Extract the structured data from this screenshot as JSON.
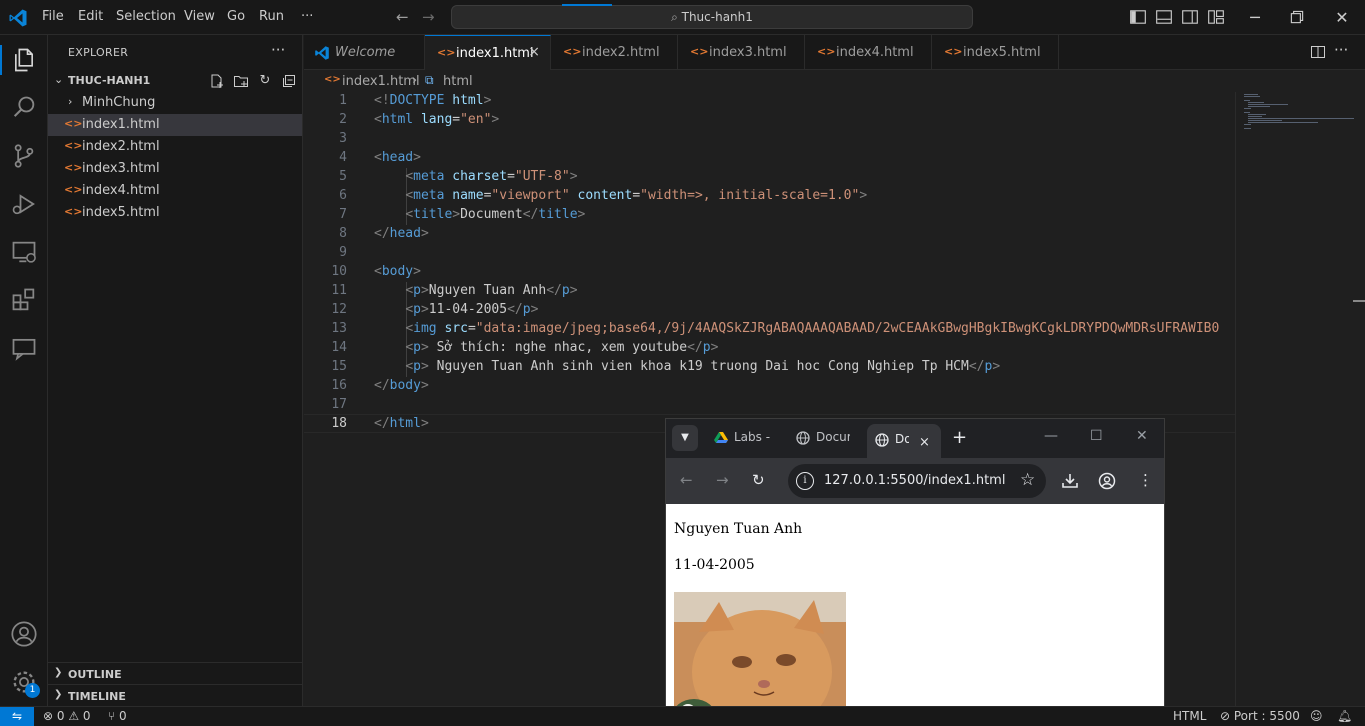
{
  "titlebar": {
    "menus": [
      "File",
      "Edit",
      "Selection",
      "View",
      "Go",
      "Run",
      "···"
    ],
    "search_text": "Thuc-hanh1"
  },
  "explorer": {
    "title": "EXPLORER",
    "more": "···",
    "folder": "THUC-HANH1",
    "items": [
      {
        "label": "MinhChung",
        "type": "folder"
      },
      {
        "label": "index1.html",
        "type": "file"
      },
      {
        "label": "index2.html",
        "type": "file"
      },
      {
        "label": "index3.html",
        "type": "file"
      },
      {
        "label": "index4.html",
        "type": "file"
      },
      {
        "label": "index5.html",
        "type": "file"
      }
    ],
    "outline": "OUTLINE",
    "timeline": "TIMELINE"
  },
  "tabs": [
    {
      "label": "Welcome"
    },
    {
      "label": "index1.html",
      "close": "×"
    },
    {
      "label": "index2.html"
    },
    {
      "label": "index3.html"
    },
    {
      "label": "index4.html"
    },
    {
      "label": "index5.html"
    }
  ],
  "breadcrumb": {
    "file": "index1.html",
    "sep": "›",
    "node": "html"
  },
  "editor": {
    "line_numbers": [
      "1",
      "2",
      "3",
      "4",
      "5",
      "6",
      "7",
      "8",
      "9",
      "10",
      "11",
      "12",
      "13",
      "14",
      "15",
      "16",
      "17",
      "18"
    ],
    "doctype": "<!DOCTYPE html>",
    "html_lang_attr": "lang",
    "html_lang_val": "\"en\"",
    "meta_charset_val": "\"UTF-8\"",
    "meta_viewport_name": "\"viewport\"",
    "meta_viewport_content": "\"width=>, initial-scale=1.0\"",
    "title_text": "Document",
    "p1_text": "Nguyen Tuan Anh",
    "p2_text": "11-04-2005",
    "img_src": "\"data:image/jpeg;base64,/9j/4AAQSkZJRgABAQAAAQABAAD/2wCEAAkGBwgHBgkIBwgKCgkLDRYPDQwMDRsUFRAWIB0",
    "p3_text": " Sở thích: nghe nhac, xem youtube",
    "p4_text": " Nguyen Tuan Anh sinh vien khoa k19 truong Dai hoc Cong Nghiep Tp HCM"
  },
  "browser": {
    "tabs": [
      "Labs -",
      "Docur",
      "Do"
    ],
    "tab_close": "×",
    "new_tab": "+",
    "url": "127.0.0.1:5500/index1.html",
    "page_lines": [
      "Nguyen Tuan Anh",
      "11-04-2005"
    ]
  },
  "statusbar": {
    "problems": "⊗ 0 ⚠ 0",
    "ports": "⑂ 0",
    "language": "HTML",
    "port": "⊘ Port : 5500",
    "accounts_badge": "1"
  },
  "colors": {
    "accent": "#0078d4",
    "tag": "#569cd6",
    "attr": "#9cdcfe",
    "string": "#ce9178",
    "html_icon": "#e37933"
  }
}
